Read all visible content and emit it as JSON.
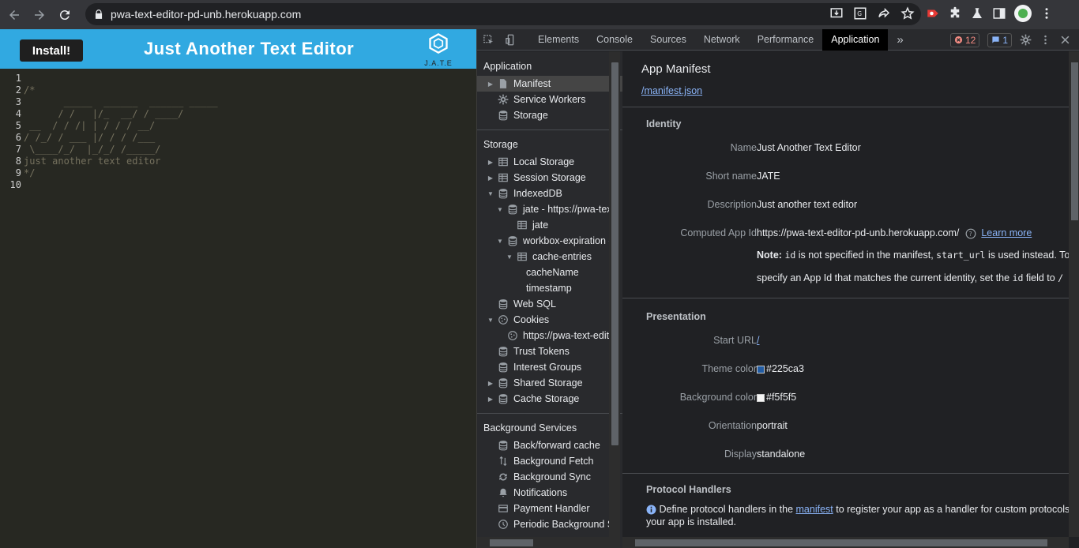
{
  "browser": {
    "url": "pwa-text-editor-pd-unb.herokuapp.com"
  },
  "app": {
    "install_label": "Install!",
    "title": "Just Another Text Editor",
    "logo_text": "J.A.T.E",
    "editor_lines": [
      {
        "no": "1",
        "text": ""
      },
      {
        "no": "2",
        "text": "/*"
      },
      {
        "no": "3",
        "text": "       _____  ______  ______ _____"
      },
      {
        "no": "4",
        "text": "      / /   |/_  __/ / ____/"
      },
      {
        "no": "5",
        "text": " __  / / /| | / / / __/"
      },
      {
        "no": "6",
        "text": "/ /_/ / ___ |/ / / /___"
      },
      {
        "no": "7",
        "text": " \\____/_/  |_/_/ /_____/"
      },
      {
        "no": "8",
        "text": "just another text editor"
      },
      {
        "no": "9",
        "text": "*/"
      },
      {
        "no": "10",
        "text": ""
      }
    ]
  },
  "devtools": {
    "tabs": [
      "Elements",
      "Console",
      "Sources",
      "Network",
      "Performance",
      "Application"
    ],
    "active_tab": "Application",
    "more": "»",
    "error_count": "12",
    "message_count": "1",
    "sidebar": {
      "application_header": "Application",
      "application_items": [
        {
          "label": "Manifest",
          "icon": "file-icon",
          "arrow": "▶",
          "indent": 0,
          "selected": true
        },
        {
          "label": "Service Workers",
          "icon": "gear-icon",
          "arrow": "",
          "indent": 0
        },
        {
          "label": "Storage",
          "icon": "database-icon",
          "arrow": "",
          "indent": 0
        }
      ],
      "storage_header": "Storage",
      "storage_items": [
        {
          "label": "Local Storage",
          "icon": "grid-icon",
          "arrow": "▶",
          "indent": 0
        },
        {
          "label": "Session Storage",
          "icon": "grid-icon",
          "arrow": "▶",
          "indent": 0
        },
        {
          "label": "IndexedDB",
          "icon": "database-icon",
          "arrow": "▼",
          "indent": 0
        },
        {
          "label": "jate - https://pwa-tex",
          "icon": "database-icon",
          "arrow": "▼",
          "indent": 1
        },
        {
          "label": "jate",
          "icon": "grid-icon",
          "arrow": "",
          "indent": 2
        },
        {
          "label": "workbox-expiration -",
          "icon": "database-icon",
          "arrow": "▼",
          "indent": 1
        },
        {
          "label": "cache-entries",
          "icon": "grid-icon",
          "arrow": "▼",
          "indent": 2
        },
        {
          "label": "cacheName",
          "icon": "",
          "arrow": "",
          "indent": 3
        },
        {
          "label": "timestamp",
          "icon": "",
          "arrow": "",
          "indent": 3
        },
        {
          "label": "Web SQL",
          "icon": "database-icon",
          "arrow": "",
          "indent": 0
        },
        {
          "label": "Cookies",
          "icon": "cookie-icon",
          "arrow": "▼",
          "indent": 0
        },
        {
          "label": "https://pwa-text-edit",
          "icon": "cookie-icon",
          "arrow": "",
          "indent": 1
        },
        {
          "label": "Trust Tokens",
          "icon": "database-icon",
          "arrow": "",
          "indent": 0
        },
        {
          "label": "Interest Groups",
          "icon": "database-icon",
          "arrow": "",
          "indent": 0
        },
        {
          "label": "Shared Storage",
          "icon": "database-icon",
          "arrow": "▶",
          "indent": 0
        },
        {
          "label": "Cache Storage",
          "icon": "database-icon",
          "arrow": "▶",
          "indent": 0
        }
      ],
      "bg_header": "Background Services",
      "bg_items": [
        {
          "label": "Back/forward cache",
          "icon": "database-icon"
        },
        {
          "label": "Background Fetch",
          "icon": "updown-icon"
        },
        {
          "label": "Background Sync",
          "icon": "sync-icon"
        },
        {
          "label": "Notifications",
          "icon": "bell-icon"
        },
        {
          "label": "Payment Handler",
          "icon": "card-icon"
        },
        {
          "label": "Periodic Background Sy",
          "icon": "clock-icon"
        }
      ]
    },
    "manifest": {
      "title": "App Manifest",
      "link": "/manifest.json",
      "identity": {
        "header": "Identity",
        "name_label": "Name",
        "name_value": "Just Another Text Editor",
        "short_label": "Short name",
        "short_value": "JATE",
        "desc_label": "Description",
        "desc_value": "Just another text editor",
        "appid_label": "Computed App Id",
        "appid_value": "https://pwa-text-editor-pd-unb.herokuapp.com/",
        "learn_more": "Learn more",
        "note_bold": "Note:",
        "note_id": "id",
        "note_text1": " is not specified in the manifest, ",
        "note_start": "start_url",
        "note_text2": " is used instead. To",
        "note_line2a": "specify an App Id that matches the current identity, set the ",
        "note_id2": "id",
        "note_line2b": " field to ",
        "note_slash": "/"
      },
      "presentation": {
        "header": "Presentation",
        "start_label": "Start URL",
        "start_value": "/",
        "theme_label": "Theme color",
        "theme_value": "#225ca3",
        "bg_label": "Background color",
        "bg_value": "#f5f5f5",
        "orient_label": "Orientation",
        "orient_value": "portrait",
        "display_label": "Display",
        "display_value": "standalone"
      },
      "protocol": {
        "header": "Protocol Handlers",
        "text1": "Define protocol handlers in the ",
        "link": "manifest",
        "text2": " to register your app as a handler for custom protocols w",
        "text3": "your app is installed."
      }
    }
  }
}
